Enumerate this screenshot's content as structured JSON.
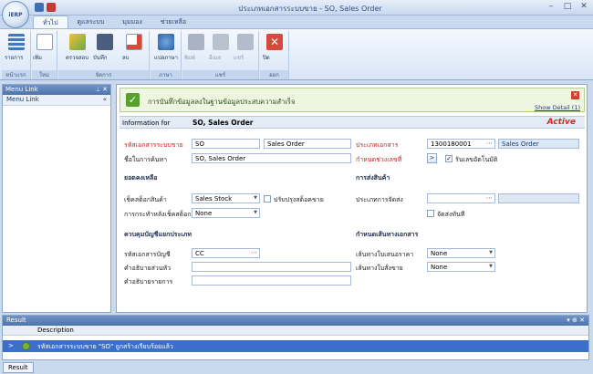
{
  "app": {
    "logo_text": "iERP",
    "window_title": "ประเภทเอกสารระบบขาย - SO, Sales Order"
  },
  "window_controls": {
    "minimize": "–",
    "maximize": "□",
    "close": "✕"
  },
  "ribbon_tabs": [
    "ทั่วไป",
    "ดูแลระบบ",
    "มุมมอง",
    "ช่วยเหลือ"
  ],
  "ribbon": {
    "groups": [
      "หน้าแรก",
      "ใหม่",
      "จัดการ",
      "ภาษา",
      "แชร์",
      "ออก"
    ],
    "buttons": {
      "list": "รายการ",
      "new": "เพิ่ม",
      "check": "ตรวจสอบ",
      "save": "บันทึก",
      "delete": "ลบ",
      "translate": "แปลภาษา",
      "print": "พิมพ์",
      "email": "อีเมล",
      "share": "แชร์",
      "close": "ปิด"
    }
  },
  "left_panel": {
    "title": "Menu Link",
    "pin": "📌",
    "close": "✕",
    "item": "Menu Link",
    "collapse": "«"
  },
  "banner": {
    "message": "การบันทึกข้อมูลลงในฐานข้อมูลประสบความสำเร็จ",
    "show_detail": "Show Detail (1)",
    "close": "✕"
  },
  "info": {
    "label": "Information for",
    "value": "SO, Sales Order",
    "status": "Active"
  },
  "form": {
    "doc_type_label": "รหัสเอกสารระบบขาย",
    "doc_type_code": "SO",
    "doc_type_name": "Sales Order",
    "search_name_label": "ชื่อในการค้นหา",
    "search_name_value": "SO, Sales Order",
    "doc_category_label": "ประเภทเอกสาร",
    "doc_category_code": "1300180001",
    "doc_category_name": "Sales Order",
    "running_label": "กำหนดช่วงเลขที่",
    "running_btn": ">",
    "auto_number_label": "รันเลขอัตโนมัติ",
    "auto_number_checked": true,
    "section_balance": "ยอดคงเหลือ",
    "stock_check_label": "เช็คสต็อกสินค้า",
    "stock_check_value": "Sales Stock",
    "adjust_stock_label": "ปรับปรุงสต็อคขาย",
    "after_check_label": "การกระทำหลังเช็คสต็อก",
    "after_check_value": "None",
    "section_delivery": "การส่งสินค้า",
    "delivery_type_label": "ประเภทการจัดส่ง",
    "delivery_type_value": "",
    "ship_now_label": "จัดส่งทันที",
    "section_account": "ควบคุมบัญชีแยกประเภท",
    "account_code_label": "รหัสเอกสารบัญชี",
    "account_code_value": "CC",
    "header_desc_label": "คำอธิบายส่วนหัว",
    "header_desc_value": "",
    "item_desc_label": "คำอธิบายรายการ",
    "item_desc_value": "",
    "section_route": "กำหนดเส้นทางเอกสาร",
    "quote_route_label": "เส้นทางใบเสนอราคา",
    "quote_route_value": "None",
    "order_route_label": "เส้นทางใบสั่งขาย",
    "order_route_value": "None"
  },
  "result": {
    "title": "Result",
    "controls": "▾ ⊕ ✕",
    "column": "Description",
    "row_marker": ">",
    "row_text": "รหัสเอกสารระบบขาย \"SO\" ถูกสร้างเรียบร้อยแล้ว"
  },
  "status_tab": "Result",
  "colors": {
    "accent": "#4d74ad",
    "required": "#cc1d1d",
    "active": "#d22a1e",
    "selection": "#3c6fc9"
  }
}
